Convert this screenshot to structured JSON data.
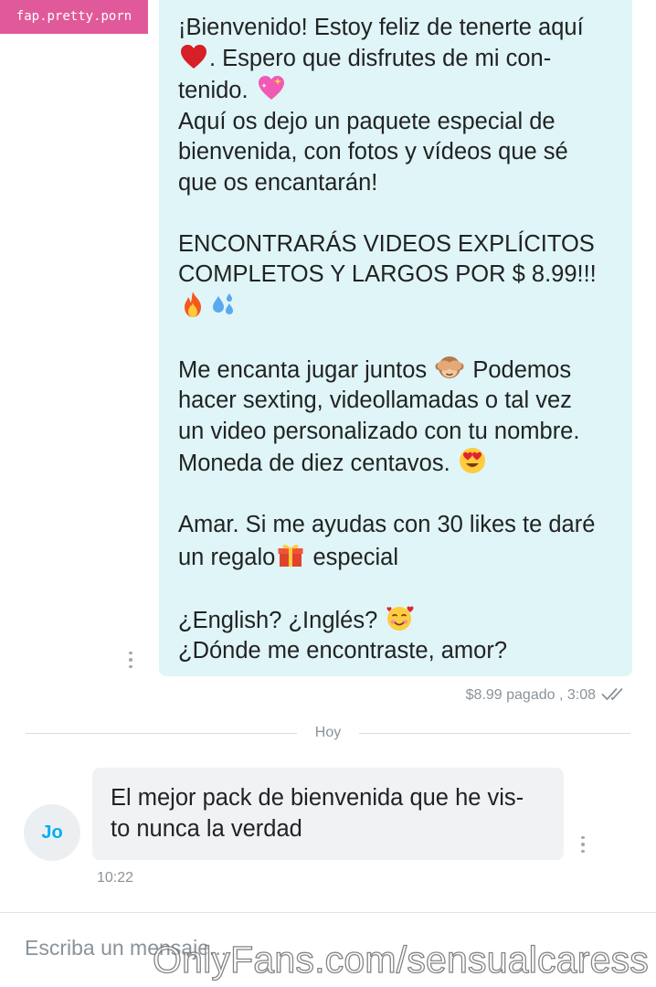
{
  "watermarks": {
    "top": "fap.pretty.porn",
    "bottom": "OnlyFans.com/sensualcaress"
  },
  "outgoing_message": {
    "line_1": "¡Bienvenido! Estoy feliz de tenerte aquí",
    "line_2": ". Espero que disfrutes de mi con-",
    "line_3": "tenido.",
    "line_4": "Aquí os dejo un paquete especial de",
    "line_5": "bienvenida, con fotos y vídeos que sé",
    "line_6": "que os encantarán!",
    "line_7": "ENCONTRARÁS VIDEOS EXPLÍCITOS",
    "line_8": "COMPLETOS Y LARGOS POR $ 8.99!!!",
    "line_9_a": "Me encanta jugar juntos",
    "line_9_b": "Podemos",
    "line_10": "hacer sexting, videollamadas o tal vez",
    "line_11": "un video personalizado con tu nombre.",
    "line_12": "Moneda de diez centavos.",
    "line_13": "Amar. Si me ayudas con 30 likes te daré",
    "line_14_a": "un regalo",
    "line_14_b": "especial",
    "line_15": "¿English? ¿Inglés?",
    "line_16": "¿Dónde me encontraste, amor?",
    "emojis": [
      "red-heart",
      "sparkling-heart",
      "fire",
      "sweat-droplets",
      "see-no-evil-monkey",
      "heart-eyes-face",
      "wrapped-gift",
      "smiling-face-with-hearts"
    ],
    "status": "$8.99 pagado , 3:08",
    "status_icon": "double-check-icon"
  },
  "date_divider": "Hoy",
  "incoming_message": {
    "avatar_initials": "Jo",
    "line_1": "El mejor pack de bienvenida que he vis-",
    "line_2": "to nunca la verdad",
    "time": "10:22"
  },
  "composer": {
    "placeholder": "Escriba un mensaje..."
  },
  "colors": {
    "outgoing_bubble": "#dff5f8",
    "incoming_bubble": "#f0f2f4",
    "avatar_text": "#00aff0",
    "muted_text": "#8a939a",
    "watermark_badge": "#e05a9b"
  }
}
